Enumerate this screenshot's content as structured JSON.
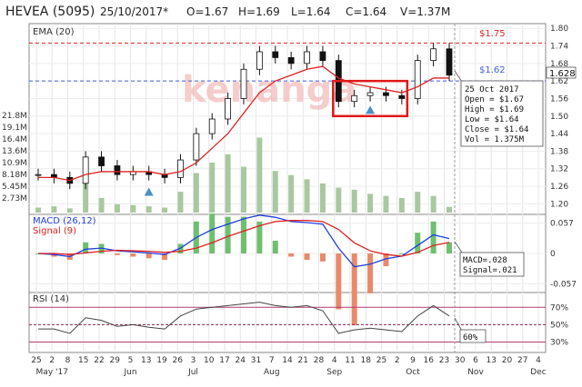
{
  "header": {
    "ticker": "HEVEA (5095)",
    "date": "25/10/2017*",
    "open": "O=1.67",
    "high": "H=1.69",
    "low": "L=1.64",
    "close": "C=1.64",
    "volume": "V=1.37M"
  },
  "watermark": "kenanga",
  "colors": {
    "up_candle": "#ffffff",
    "down_candle": "#111111",
    "ema": "#e02020",
    "volume_bar": "#a9c8a0",
    "macd": "#2040e0",
    "signal": "#e02020",
    "hist_pos": "#6fbf6f",
    "hist_neg": "#e88a6a",
    "rsi": "#444444",
    "highlight_box": "#e01818",
    "marker": "#4a90c8",
    "level_line": "#e02020",
    "level_line_blue": "#4060e0"
  },
  "panels": {
    "price": {
      "label": "EMA (20)",
      "axis_ticks": [
        "1.80",
        "1.74",
        "1.68",
        "1.62",
        "1.56",
        "1.50",
        "1.44",
        "1.38",
        "1.32",
        "1.26",
        "1.20"
      ],
      "current_price": "1.628",
      "level_high": "$1.75",
      "level_low": "$1.62",
      "volume_ticks": [
        "21.8M",
        "19.1M",
        "16.4M",
        "13.6M",
        "10.9M",
        "8.18M",
        "5.45M",
        "2.73M"
      ]
    },
    "macd": {
      "label_main": "MACD (26,12)",
      "label_signal": "Signal (9)",
      "axis_ticks": [
        "0.057",
        "0",
        "-0.057"
      ],
      "readout_macd": "MACD=.028",
      "readout_signal": "Signal=.021"
    },
    "rsi": {
      "label": "RSI (14)",
      "axis_ticks": [
        "70%",
        "50%",
        "30%"
      ],
      "readout": "60%"
    }
  },
  "tooltip": {
    "date": "25 Oct 2017",
    "open": "Open  = $1.67",
    "high": "High  = $1.69",
    "low": "Low   = $1.64",
    "close": "Close = $1.64",
    "vol": "Vol   = 1.375M"
  },
  "x_axis": {
    "day_ticks": [
      "25",
      "2",
      "8",
      "15",
      "22",
      "29",
      "5",
      "13",
      "19",
      "26",
      "3",
      "10",
      "17",
      "24",
      "31",
      "7",
      "14",
      "21",
      "28",
      "4",
      "11",
      "18",
      "25",
      "2",
      "9",
      "16",
      "23",
      "30",
      "6",
      "13",
      "20",
      "27",
      "4"
    ],
    "month_labels": [
      "May '17",
      "Jun",
      "Jul",
      "Aug",
      "Sep",
      "Oct",
      "Nov",
      "Dec"
    ]
  },
  "chart_data": {
    "type": "candlestick",
    "x": [
      "2017-04-25",
      "2017-05-02",
      "2017-05-08",
      "2017-05-15",
      "2017-05-22",
      "2017-05-29",
      "2017-06-05",
      "2017-06-13",
      "2017-06-19",
      "2017-06-26",
      "2017-07-03",
      "2017-07-10",
      "2017-07-17",
      "2017-07-24",
      "2017-07-31",
      "2017-08-07",
      "2017-08-14",
      "2017-08-21",
      "2017-08-28",
      "2017-09-04",
      "2017-09-11",
      "2017-09-18",
      "2017-09-25",
      "2017-10-02",
      "2017-10-09",
      "2017-10-16",
      "2017-10-23"
    ],
    "close": [
      1.3,
      1.29,
      1.27,
      1.36,
      1.33,
      1.3,
      1.31,
      1.3,
      1.29,
      1.35,
      1.44,
      1.49,
      1.56,
      1.66,
      1.72,
      1.7,
      1.68,
      1.72,
      1.69,
      1.55,
      1.57,
      1.58,
      1.57,
      1.56,
      1.69,
      1.73,
      1.64
    ],
    "ema20": [
      1.29,
      1.29,
      1.28,
      1.3,
      1.31,
      1.31,
      1.31,
      1.31,
      1.3,
      1.31,
      1.34,
      1.39,
      1.44,
      1.51,
      1.58,
      1.62,
      1.64,
      1.66,
      1.67,
      1.63,
      1.61,
      1.6,
      1.59,
      1.58,
      1.6,
      1.63,
      1.63
    ],
    "volume": [
      1.2,
      1.5,
      1.0,
      8.0,
      3.5,
      2.0,
      1.8,
      1.5,
      1.2,
      5.0,
      9.5,
      12.0,
      14.0,
      11.0,
      18.0,
      10.0,
      9.0,
      8.0,
      7.0,
      6.0,
      5.5,
      4.5,
      4.0,
      3.5,
      5.0,
      4.0,
      1.375
    ],
    "macd": [
      0.0,
      -0.002,
      -0.006,
      0.008,
      0.01,
      0.005,
      0.003,
      0.001,
      -0.002,
      0.01,
      0.03,
      0.045,
      0.055,
      0.065,
      0.072,
      0.068,
      0.06,
      0.058,
      0.055,
      0.01,
      -0.025,
      -0.02,
      -0.01,
      -0.005,
      0.015,
      0.035,
      0.028
    ],
    "signal": [
      0.0,
      0.0,
      -0.002,
      0.001,
      0.004,
      0.006,
      0.005,
      0.004,
      0.002,
      0.004,
      0.01,
      0.02,
      0.032,
      0.042,
      0.052,
      0.06,
      0.062,
      0.062,
      0.06,
      0.045,
      0.02,
      0.005,
      -0.002,
      -0.005,
      0.002,
      0.015,
      0.021
    ],
    "rsi": [
      45,
      45,
      40,
      58,
      55,
      48,
      50,
      47,
      45,
      60,
      68,
      70,
      72,
      74,
      76,
      72,
      70,
      72,
      66,
      40,
      44,
      46,
      44,
      42,
      60,
      72,
      60
    ],
    "y_range_price": [
      1.17,
      1.81
    ],
    "y_range_macd": [
      -0.07,
      0.07
    ],
    "y_range_rsi": [
      20,
      85
    ],
    "volume_max": 24,
    "highlight_range": [
      "2017-09-04",
      "2017-10-02"
    ],
    "markers": [
      "2017-06-13",
      "2017-09-18"
    ]
  }
}
